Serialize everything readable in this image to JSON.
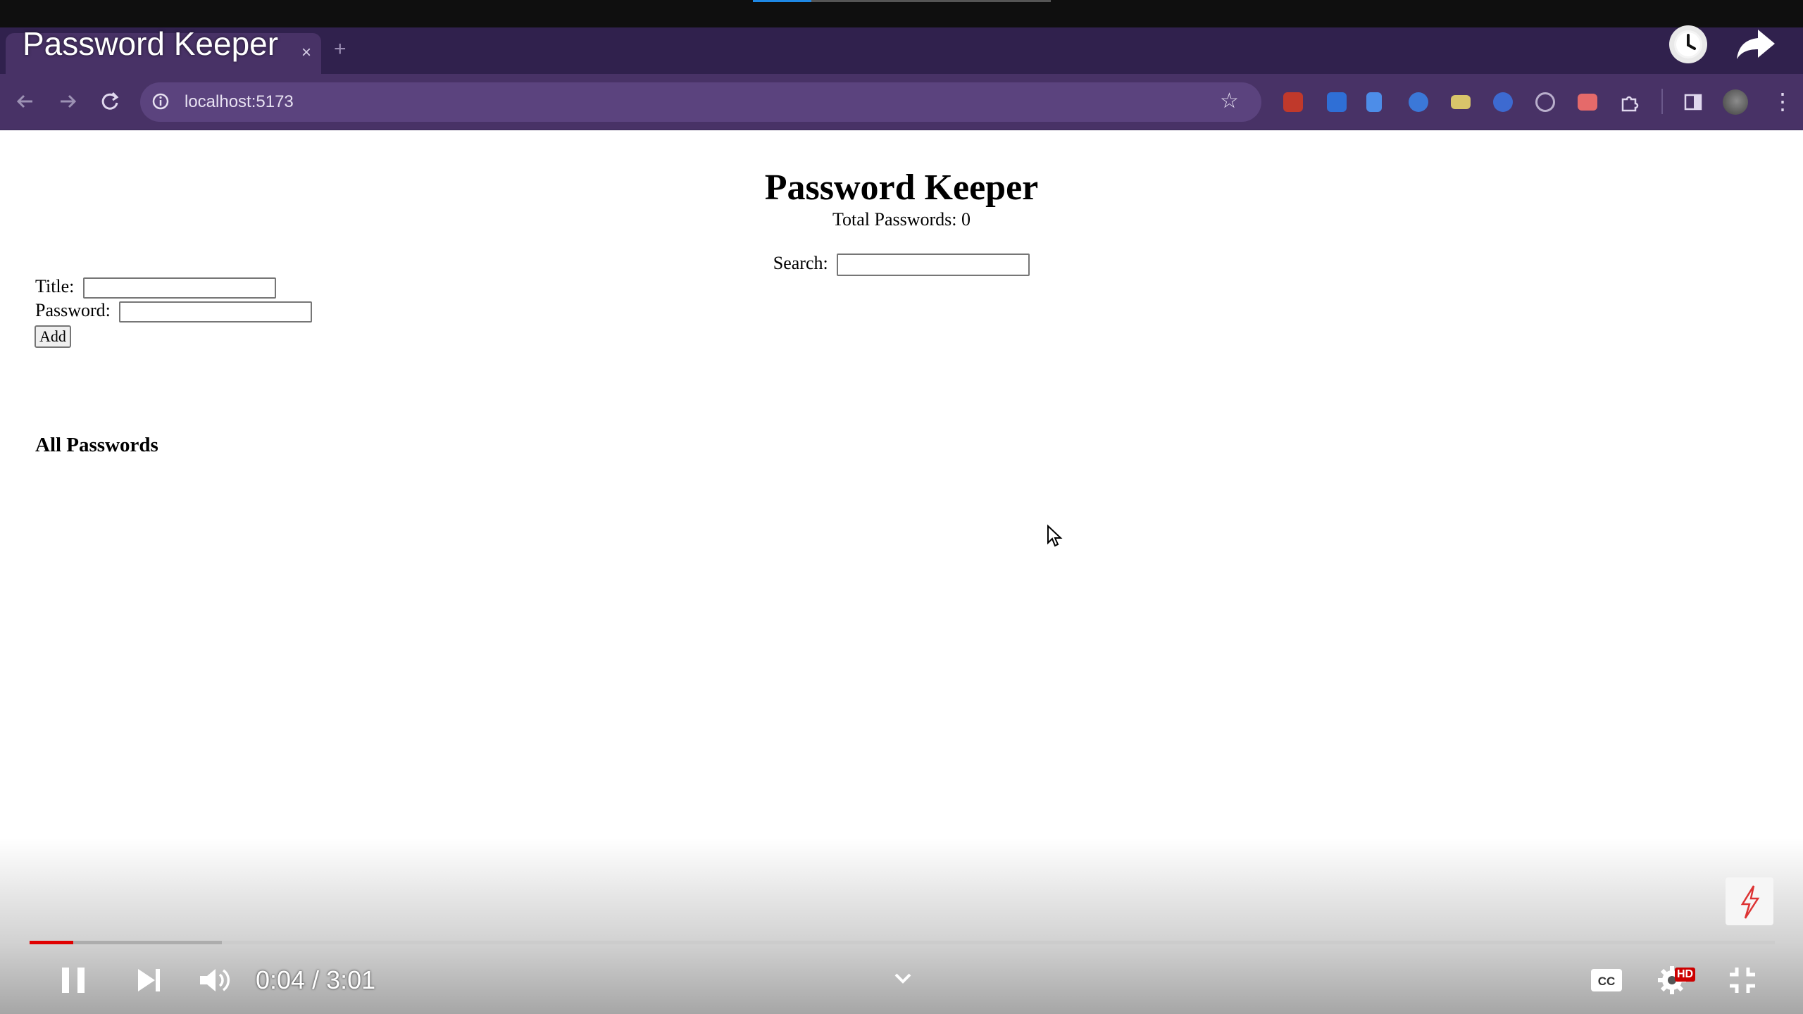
{
  "video_overlay": {
    "title": "Password Keeper",
    "time_current": "0:04",
    "time_separator": " / ",
    "time_total": "3:01",
    "progress_played_fraction": 0.025,
    "progress_buffered_fraction": 0.11,
    "quality_badge": "HD"
  },
  "browser": {
    "url": "localhost:5173",
    "new_tab_label": "+",
    "tab_close_label": "×",
    "menu_label": "⋮"
  },
  "app": {
    "title": "Password Keeper",
    "total_label": "Total Passwords: 0",
    "search_label": "Search:",
    "search_value": "",
    "title_label": "Title:",
    "title_value": "",
    "password_label": "Password:",
    "password_value": "",
    "add_button": "Add",
    "all_passwords_heading": "All Passwords"
  },
  "colors": {
    "tab_strip": "#30214d",
    "toolbar": "#483266",
    "progress_played": "#e00000"
  }
}
